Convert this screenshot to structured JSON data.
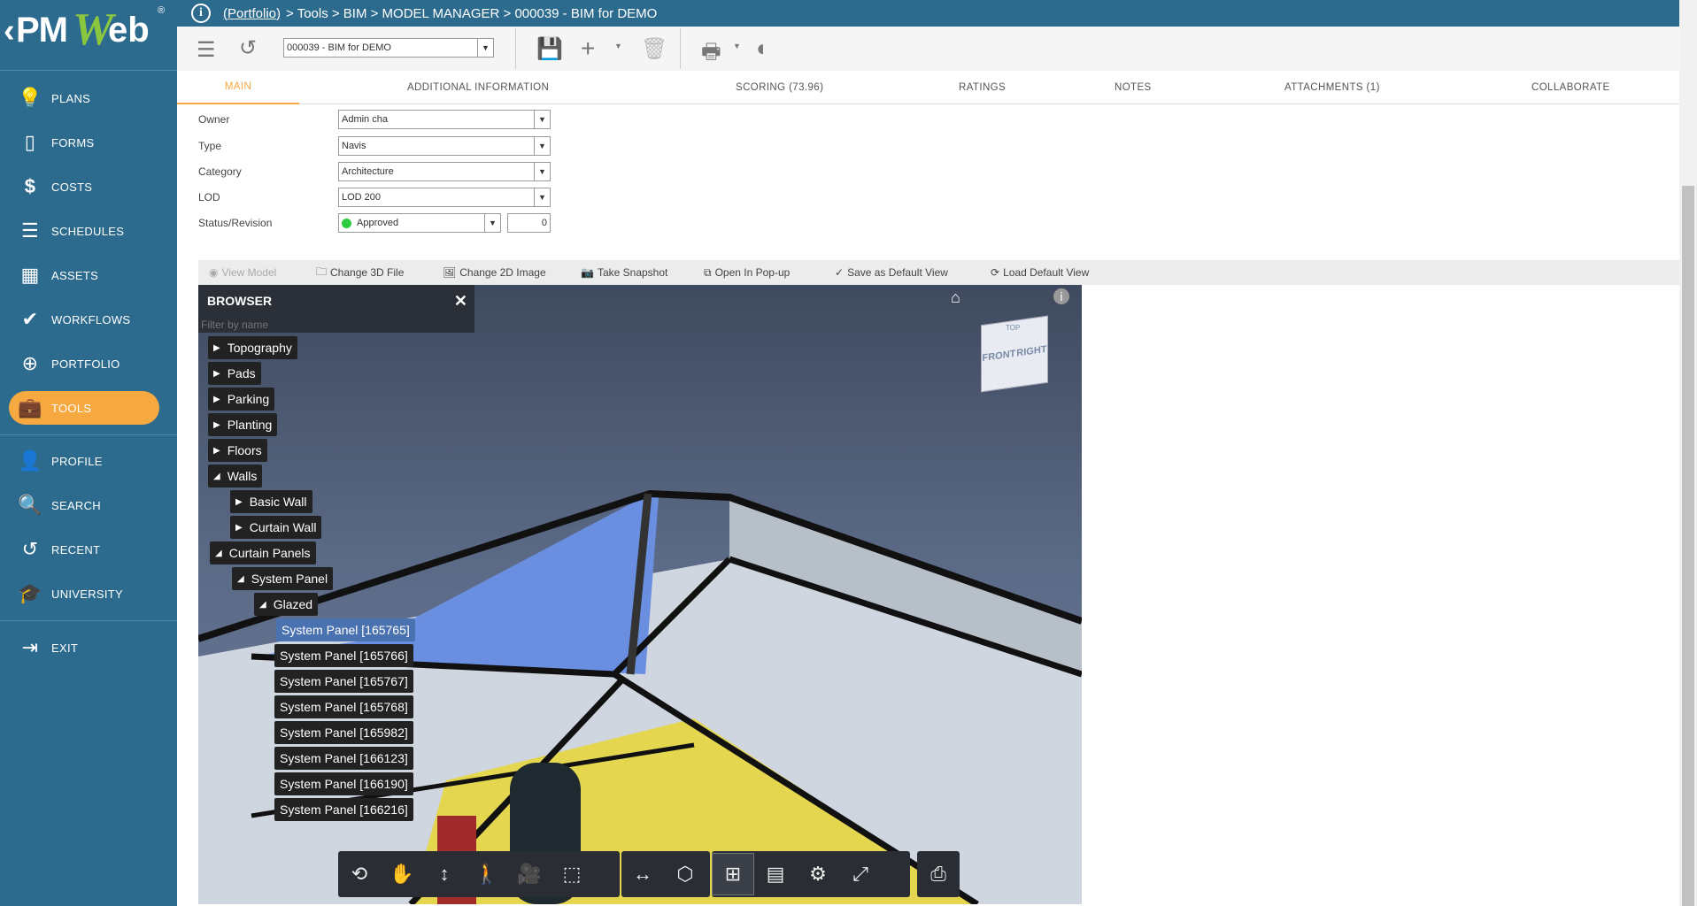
{
  "logo": {
    "text": "PMWeb",
    "reg": "®"
  },
  "sidebar": {
    "items": [
      {
        "label": "PLANS",
        "icon": "lightbulb-icon"
      },
      {
        "label": "FORMS",
        "icon": "document-icon"
      },
      {
        "label": "COSTS",
        "icon": "dollar-icon"
      },
      {
        "label": "SCHEDULES",
        "icon": "schedule-icon"
      },
      {
        "label": "ASSETS",
        "icon": "building-icon"
      },
      {
        "label": "WORKFLOWS",
        "icon": "check-icon"
      },
      {
        "label": "PORTFOLIO",
        "icon": "globe-icon"
      },
      {
        "label": "TOOLS",
        "icon": "briefcase-icon",
        "active": true
      },
      {
        "label": "PROFILE",
        "icon": "person-icon"
      },
      {
        "label": "SEARCH",
        "icon": "search-icon"
      },
      {
        "label": "RECENT",
        "icon": "history-icon"
      },
      {
        "label": "UNIVERSITY",
        "icon": "graduation-cap-icon"
      },
      {
        "label": "EXIT",
        "icon": "exit-icon"
      }
    ]
  },
  "breadcrumb": {
    "portfolio": "(Portfolio)",
    "rest": "> Tools > BIM > MODEL MANAGER > 000039 - BIM for DEMO"
  },
  "toolbar": {
    "record_select": "000039 - BIM for DEMO"
  },
  "tabs": [
    "MAIN",
    "ADDITIONAL INFORMATION",
    "SCORING (73.96)",
    "RATINGS",
    "NOTES",
    "ATTACHMENTS (1)",
    "COLLABORATE"
  ],
  "form": {
    "owner_label": "Owner",
    "owner_value": "Admin cha",
    "type_label": "Type",
    "type_value": "Navis",
    "category_label": "Category",
    "category_value": "Architecture",
    "lod_label": "LOD",
    "lod_value": "LOD 200",
    "status_label": "Status/Revision",
    "status_value": "Approved",
    "revision_value": "0",
    "status_color": "#2ecc40"
  },
  "viewer_toolbar": [
    "View Model",
    "Change 3D File",
    "Change 2D Image",
    "Take Snapshot",
    "Open In Pop-up",
    "Save as Default View",
    "Load Default View"
  ],
  "browser": {
    "title": "BROWSER",
    "filter_placeholder": "Filter by name",
    "nodes": [
      "Topography",
      "Pads",
      "Parking",
      "Planting",
      "Floors",
      "Walls",
      "Basic Wall",
      "Curtain Wall",
      "Curtain Panels",
      "System Panel",
      "Glazed",
      "System Panel [165765]",
      "System Panel [165766]",
      "System Panel [165767]",
      "System Panel [165768]",
      "System Panel [165982]",
      "System Panel [166123]",
      "System Panel [166190]",
      "System Panel [166216]"
    ]
  },
  "viewcube": {
    "top": "TOP",
    "front": "FRONT",
    "right": "RIGHT"
  },
  "colors": {
    "sidebar": "#2c6b8e",
    "accent": "#f7a941",
    "selection": "#4a72b0"
  }
}
